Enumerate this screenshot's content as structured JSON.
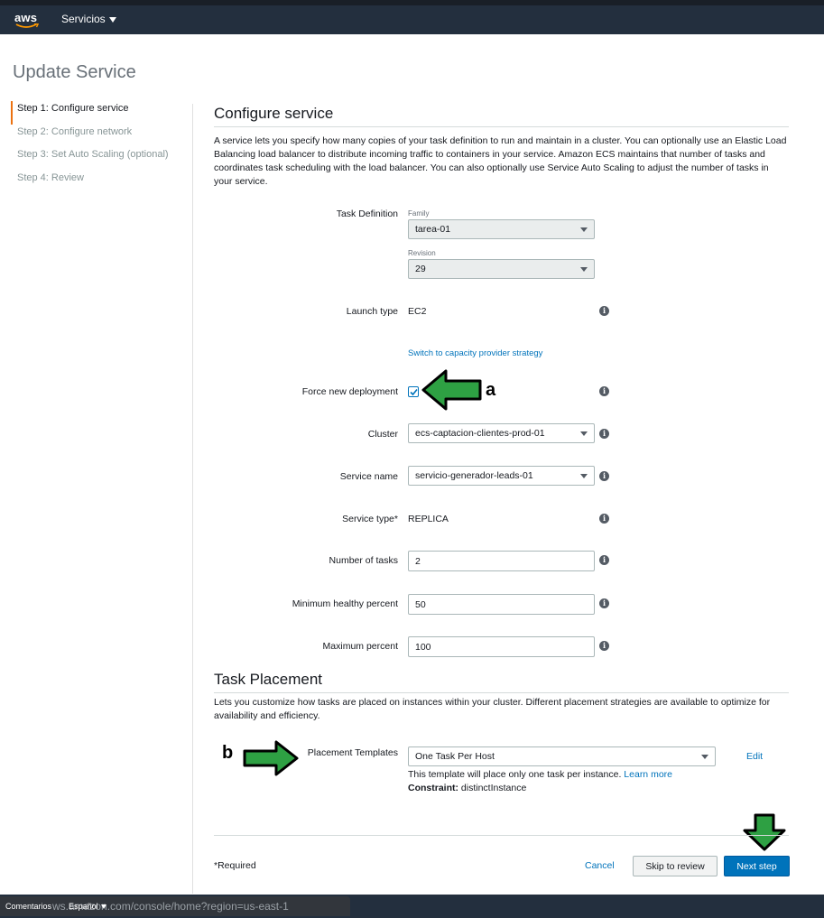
{
  "topnav": {
    "logo": "aws",
    "services_label": "Servicios"
  },
  "page_title": "Update Service",
  "steps": [
    "Step 1: Configure service",
    "Step 2: Configure network",
    "Step 3: Set Auto Scaling (optional)",
    "Step 4: Review"
  ],
  "configure": {
    "title": "Configure service",
    "description": "A service lets you specify how many copies of your task definition to run and maintain in a cluster. You can optionally use an Elastic Load Balancing load balancer to distribute incoming traffic to containers in your service. Amazon ECS maintains that number of tasks and coordinates task scheduling with the load balancer. You can also optionally use Service Auto Scaling to adjust the number of tasks in your service.",
    "task_definition_label": "Task Definition",
    "family_label": "Family",
    "family_value": "tarea-01",
    "revision_label": "Revision",
    "revision_value": "29",
    "launch_type_label": "Launch type",
    "launch_type_value": "EC2",
    "switch_link": "Switch to capacity provider strategy",
    "force_label": "Force new deployment",
    "force_checked": true,
    "cluster_label": "Cluster",
    "cluster_value": "ecs-captacion-clientes-prod-01",
    "service_name_label": "Service name",
    "service_name_value": "servicio-generador-leads-01",
    "service_type_label": "Service type*",
    "service_type_value": "REPLICA",
    "num_tasks_label": "Number of tasks",
    "num_tasks_value": "2",
    "min_healthy_label": "Minimum healthy percent",
    "min_healthy_value": "50",
    "max_percent_label": "Maximum percent",
    "max_percent_value": "100"
  },
  "placement": {
    "title": "Task Placement",
    "description": "Lets you customize how tasks are placed on instances within your cluster. Different placement strategies are available to optimize for availability and efficiency.",
    "templates_label": "Placement Templates",
    "template_value": "One Task Per Host",
    "edit_link": "Edit",
    "help_text": "This template will place only one task per instance.",
    "learn_more": "Learn more",
    "constraint_label": "Constraint:",
    "constraint_value": "distinctInstance"
  },
  "annotations": {
    "a": "a",
    "b": "b",
    "arrow_color": "#2ea043"
  },
  "actions": {
    "required": "*Required",
    "cancel": "Cancel",
    "skip": "Skip to review",
    "next": "Next step"
  },
  "footer": {
    "feedback": "Comentarios",
    "language": "Español",
    "url": "ws.amazon.com/console/home?region=us-east-1"
  }
}
